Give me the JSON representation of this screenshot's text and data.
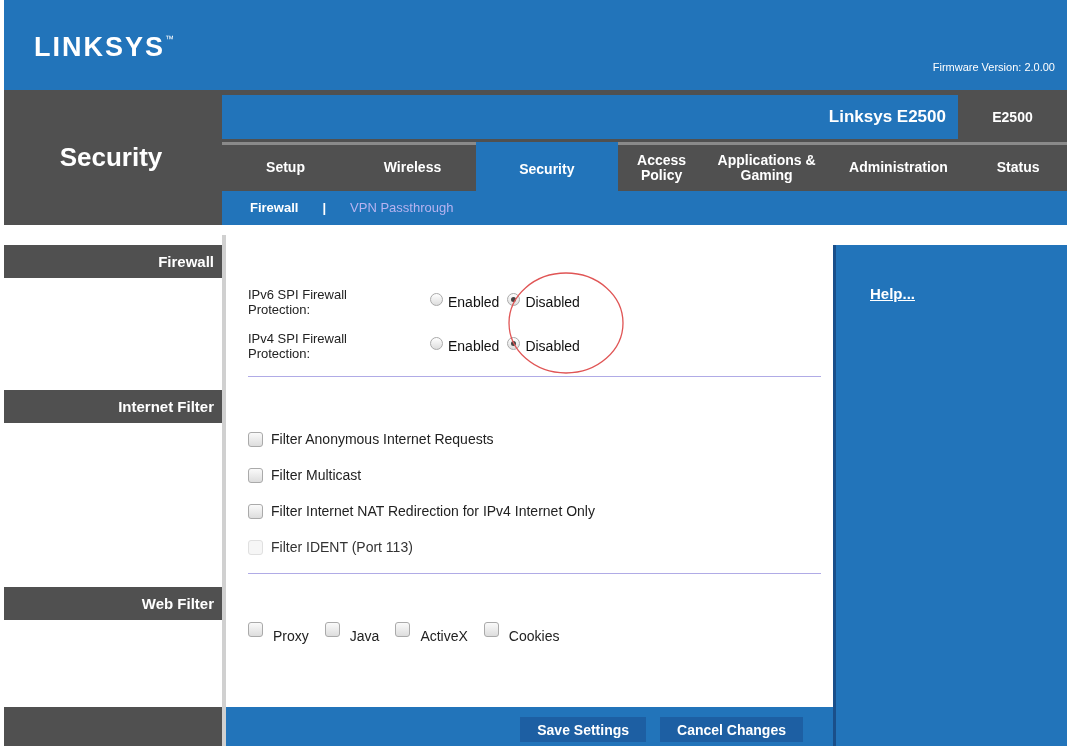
{
  "header": {
    "logo": "LINKSYS",
    "trademark": "™",
    "firmware": "Firmware Version: 2.0.00"
  },
  "page_title": "Security",
  "model_bar": {
    "name": "Linksys E2500",
    "model": "E2500"
  },
  "tabs": [
    {
      "label": "Setup",
      "selected": false
    },
    {
      "label": "Wireless",
      "selected": false
    },
    {
      "label": "Security",
      "selected": true
    },
    {
      "label": "Access Policy",
      "selected": false
    },
    {
      "label": "Applications & Gaming",
      "selected": false
    },
    {
      "label": "Administration",
      "selected": false
    },
    {
      "label": "Status",
      "selected": false
    }
  ],
  "subtabs": [
    {
      "label": "Firewall",
      "selected": true
    },
    {
      "label": "VPN Passthrough",
      "selected": false
    }
  ],
  "subtab_separator": "|",
  "sections": [
    {
      "title": "Firewall"
    },
    {
      "title": "Internet Filter"
    },
    {
      "title": "Web Filter"
    }
  ],
  "firewall": [
    {
      "label": "IPv6 SPI Firewall Protection:",
      "options": [
        {
          "label": "Enabled",
          "selected": false
        },
        {
          "label": "Disabled",
          "selected": true
        }
      ]
    },
    {
      "label": "IPv4 SPI Firewall Protection:",
      "options": [
        {
          "label": "Enabled",
          "selected": false
        },
        {
          "label": "Disabled",
          "selected": true
        }
      ]
    }
  ],
  "internet_filter": [
    {
      "label": "Filter Anonymous Internet Requests",
      "checked": false,
      "disabled": false
    },
    {
      "label": "Filter Multicast",
      "checked": false,
      "disabled": false
    },
    {
      "label": "Filter Internet NAT Redirection for IPv4 Internet Only",
      "checked": false,
      "disabled": false
    },
    {
      "label": "Filter IDENT (Port 113)",
      "checked": false,
      "disabled": true
    }
  ],
  "web_filter": [
    {
      "label": "Proxy",
      "checked": false
    },
    {
      "label": "Java",
      "checked": false
    },
    {
      "label": "ActiveX",
      "checked": false
    },
    {
      "label": "Cookies",
      "checked": false
    }
  ],
  "help_link": "Help...",
  "buttons": [
    "Save Settings",
    "Cancel Changes"
  ]
}
